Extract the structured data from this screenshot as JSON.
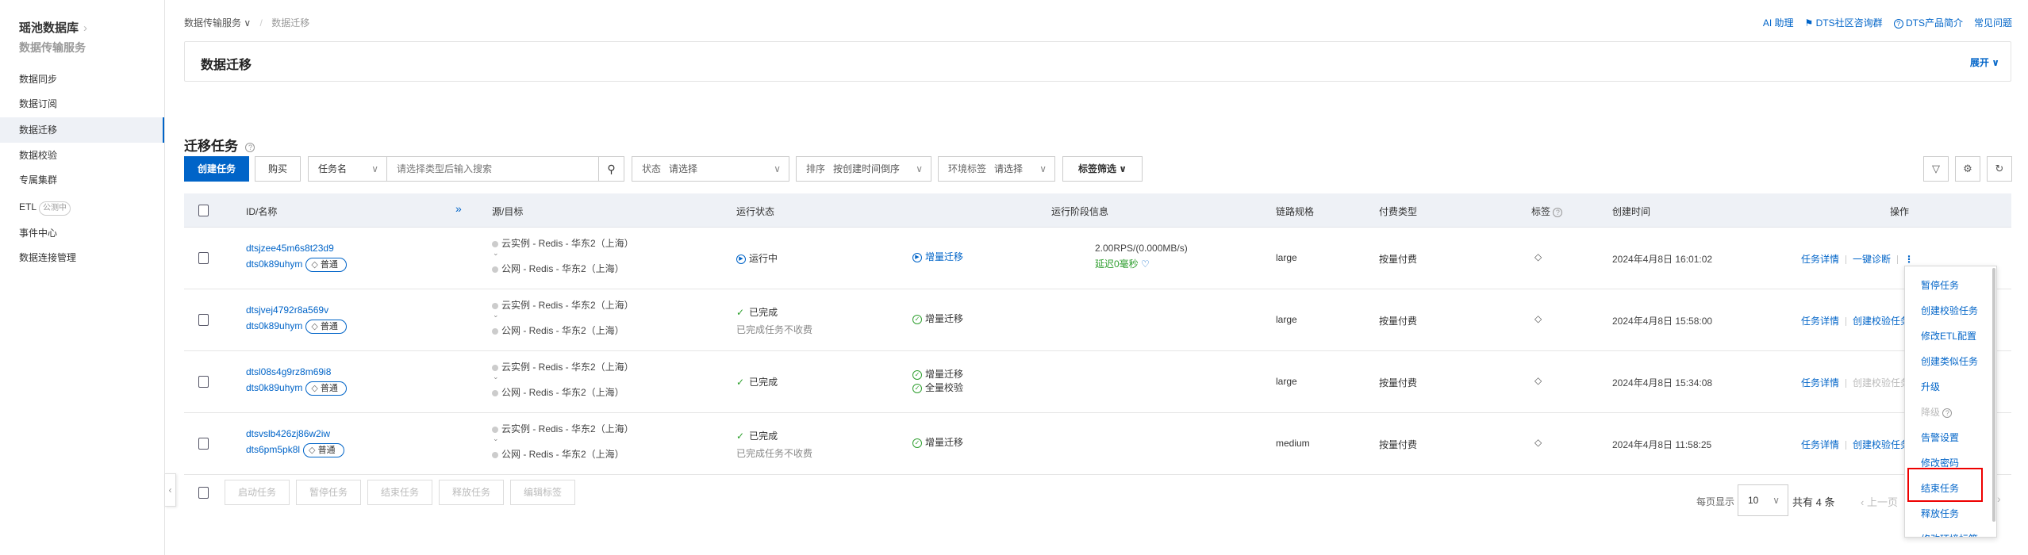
{
  "sidebar": {
    "title": "瑶池数据库",
    "subtitle": "数据传输服务",
    "items": [
      {
        "label": "数据同步"
      },
      {
        "label": "数据订阅"
      },
      {
        "label": "数据迁移",
        "active": true
      },
      {
        "label": "数据校验"
      },
      {
        "label": "专属集群"
      },
      {
        "label": "ETL",
        "badge": "公测中"
      },
      {
        "label": "事件中心"
      },
      {
        "label": "数据连接管理"
      }
    ]
  },
  "breadcrumb": {
    "parent": "数据传输服务",
    "current": "数据迁移"
  },
  "header_links": {
    "ai": "AI 助理",
    "community": "DTS社区咨询群",
    "intro": "DTS产品简介",
    "faq": "常见问题"
  },
  "banner": {
    "title": "数据迁移",
    "expand": "展开"
  },
  "section": {
    "title": "迁移任务"
  },
  "toolbar": {
    "create": "创建任务",
    "buy": "购买",
    "search_type": "任务名",
    "search_placeholder": "请选择类型后输入搜索",
    "status_label": "状态",
    "status_value": "请选择",
    "sort_label": "排序",
    "sort_value": "按创建时间倒序",
    "env_label": "环境标签",
    "env_value": "请选择",
    "tag_filter": "标签筛选"
  },
  "columns": {
    "id": "ID/名称",
    "src": "源/目标",
    "status": "运行状态",
    "stage": "运行阶段信息",
    "spec": "链路规格",
    "billing": "付费类型",
    "tag": "标签",
    "created": "创建时间",
    "ops": "操作"
  },
  "rows": [
    {
      "id": "dtsjzee45m6s8t23d9",
      "name": "dts0k89uhym",
      "tag": "普通",
      "source": "云实例 - Redis - 华东2（上海）",
      "target": "公网 - Redis - 华东2（上海）",
      "status": "运行中",
      "status_icon": "running",
      "status_note": "",
      "stages": [
        {
          "label": "增量迁移",
          "state": "running"
        }
      ],
      "rps": "2.00RPS/(0.000MB/s)",
      "delay": "延迟0毫秒",
      "spec": "large",
      "billing": "按量付费",
      "created": "2024年4月8日 16:01:02",
      "actions": [
        {
          "label": "任务详情"
        },
        {
          "label": "一键诊断"
        }
      ],
      "kebab": true
    },
    {
      "id": "dtsjvej4792r8a569v",
      "name": "dts0k89uhym",
      "tag": "普通",
      "source": "云实例 - Redis - 华东2（上海）",
      "target": "公网 - Redis - 华东2（上海）",
      "status": "已完成",
      "status_icon": "done",
      "status_note": "已完成任务不收费",
      "stages": [
        {
          "label": "增量迁移",
          "state": "done"
        }
      ],
      "rps": "",
      "delay": "",
      "spec": "large",
      "billing": "按量付费",
      "created": "2024年4月8日 15:58:00",
      "actions": [
        {
          "label": "任务详情"
        },
        {
          "label": "创建校验任务"
        }
      ]
    },
    {
      "id": "dtsl08s4g9rz8m69i8",
      "name": "dts0k89uhym",
      "tag": "普通",
      "source": "云实例 - Redis - 华东2（上海）",
      "target": "公网 - Redis - 华东2（上海）",
      "status": "已完成",
      "status_icon": "done",
      "status_note": "",
      "stages": [
        {
          "label": "增量迁移",
          "state": "done"
        },
        {
          "label": "全量校验",
          "state": "done"
        }
      ],
      "rps": "",
      "delay": "",
      "spec": "large",
      "billing": "按量付费",
      "created": "2024年4月8日 15:34:08",
      "actions": [
        {
          "label": "任务详情"
        },
        {
          "label": "创建校验任务",
          "disabled": true
        }
      ]
    },
    {
      "id": "dtsvslb426zj86w2iw",
      "name": "dts6pm5pk8l",
      "tag": "普通",
      "source": "云实例 - Redis - 华东2（上海）",
      "target": "公网 - Redis - 华东2（上海）",
      "status": "已完成",
      "status_icon": "done",
      "status_note": "已完成任务不收费",
      "stages": [
        {
          "label": "增量迁移",
          "state": "done"
        }
      ],
      "rps": "",
      "delay": "",
      "spec": "medium",
      "billing": "按量付费",
      "created": "2024年4月8日 11:58:25",
      "actions": [
        {
          "label": "任务详情"
        },
        {
          "label": "创建校验任务"
        }
      ]
    }
  ],
  "footer": {
    "buttons": [
      "启动任务",
      "暂停任务",
      "结束任务",
      "释放任务",
      "编辑标签"
    ]
  },
  "pagination": {
    "per_page_label": "每页显示",
    "per_page": "10",
    "total": "共有 4 条",
    "prev": "上一页"
  },
  "menu": {
    "items": [
      {
        "label": "暂停任务"
      },
      {
        "label": "创建校验任务"
      },
      {
        "label": "修改ETL配置"
      },
      {
        "label": "创建类似任务"
      },
      {
        "label": "升级"
      },
      {
        "label": "降级",
        "disabled": true
      },
      {
        "label": "告警设置"
      },
      {
        "label": "修改密码"
      },
      {
        "label": "结束任务",
        "highlighted": true
      },
      {
        "label": "释放任务"
      },
      {
        "label": "修改环境标签"
      }
    ]
  },
  "colors": {
    "primary": "#0064c8",
    "success": "#2e9e2e",
    "highlight": "#e00000",
    "header_bg": "#eef1f6"
  }
}
